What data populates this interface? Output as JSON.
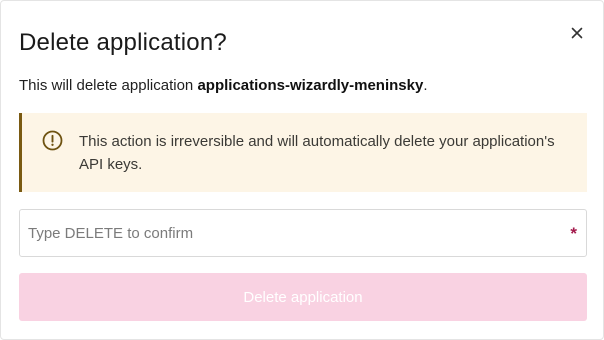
{
  "dialog": {
    "title": "Delete application?",
    "close_icon": "close-icon",
    "description_prefix": "This will delete application ",
    "application_name": "applications-wizardly-meninsky",
    "description_suffix": "."
  },
  "warning": {
    "icon": "alert-circle-icon",
    "text": "This action is irreversible and will automatically delete your application's API keys.",
    "background": "#fdf5e6",
    "accent": "#7a5a12"
  },
  "confirm_field": {
    "value": "",
    "placeholder": "Type DELETE to confirm",
    "required_mark": "*"
  },
  "delete_button": {
    "label": "Delete application",
    "state": "disabled",
    "color": "#f9d2e2"
  }
}
